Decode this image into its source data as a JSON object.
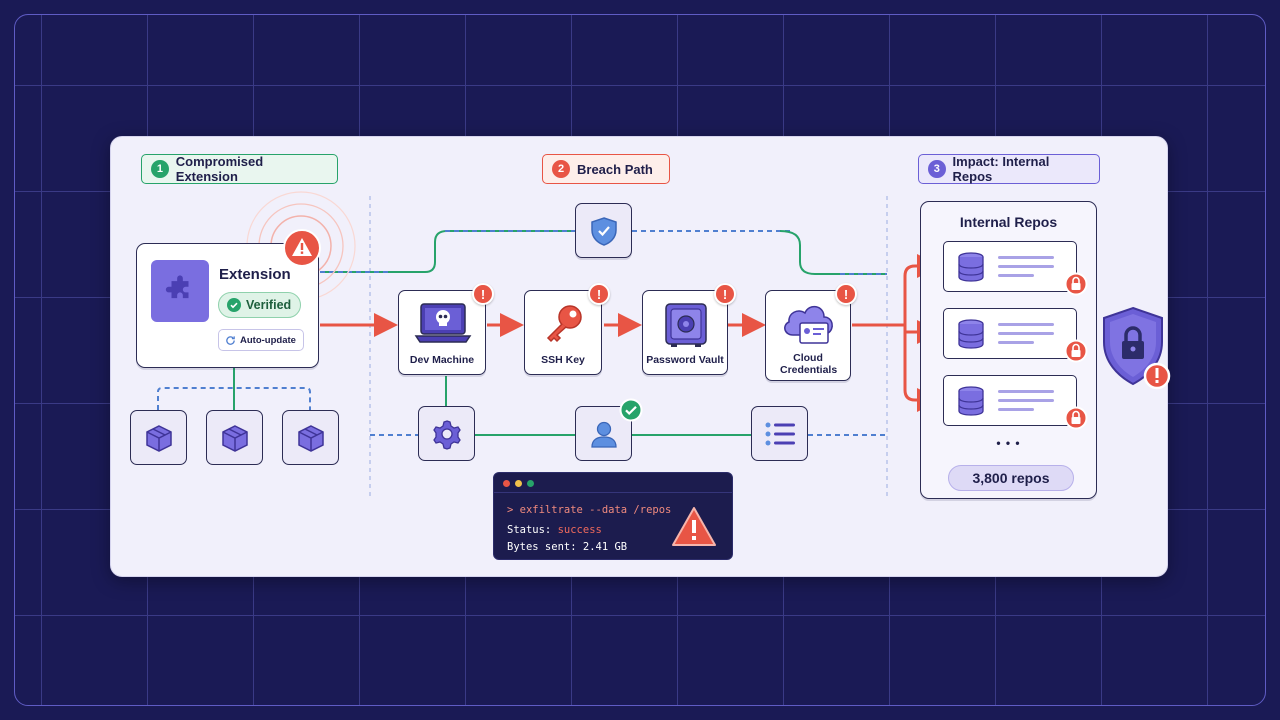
{
  "sections": {
    "compromised": {
      "num": "1",
      "label": "Compromised Extension"
    },
    "breach": {
      "num": "2",
      "label": "Breach Path"
    },
    "impact": {
      "num": "3",
      "label": "Impact: Internal Repos"
    }
  },
  "extension": {
    "title": "Extension",
    "verified_label": "Verified",
    "autoupdate_label": "Auto-update"
  },
  "breach_nodes": [
    {
      "label": "Dev Machine",
      "icon": "skull-laptop-icon"
    },
    {
      "label": "SSH Key",
      "icon": "key-icon"
    },
    {
      "label": "Password Vault",
      "icon": "vault-icon"
    },
    {
      "label": "Cloud Credentials",
      "icon": "cloud-credentials-icon"
    }
  ],
  "terminal": {
    "command": "> exfiltrate --data /repos",
    "status_label": "Status:",
    "status_value": "success",
    "bytes_label": "Bytes sent:",
    "bytes_value": "2.41 GB"
  },
  "repos": {
    "title": "Internal Repos",
    "ellipsis": "• • •",
    "count_label": "3,800 repos"
  },
  "colors": {
    "background": "#1a1a55",
    "panel": "#f1f0fb",
    "green": "#27a36a",
    "red": "#e85545",
    "purple": "#6b5fd6",
    "blue_dashed": "#4f7fd0"
  }
}
